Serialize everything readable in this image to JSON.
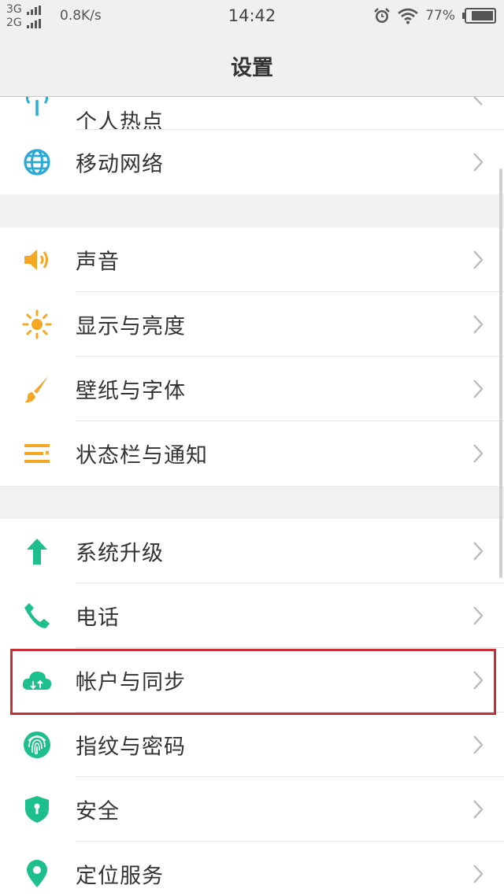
{
  "status": {
    "net1": "3G",
    "net2": "2G",
    "speed": "0.8K/s",
    "time": "14:42",
    "battery": "77%"
  },
  "header": {
    "title": "设置"
  },
  "groups": [
    {
      "items": [
        {
          "label": "个人热点",
          "icon": "hotspot-icon",
          "color": "#2ab0d6"
        },
        {
          "label": "移动网络",
          "icon": "globe-icon",
          "color": "#2aa8d6"
        }
      ]
    },
    {
      "items": [
        {
          "label": "声音",
          "icon": "speaker-icon",
          "color": "#f5a623"
        },
        {
          "label": "显示与亮度",
          "icon": "sun-icon",
          "color": "#f5a623"
        },
        {
          "label": "壁纸与字体",
          "icon": "brush-icon",
          "color": "#f5a623"
        },
        {
          "label": "状态栏与通知",
          "icon": "menu-list-icon",
          "color": "#f5a623"
        }
      ]
    },
    {
      "items": [
        {
          "label": "系统升级",
          "icon": "upgrade-arrow-icon",
          "color": "#1dbf8c"
        },
        {
          "label": "电话",
          "icon": "phone-icon",
          "color": "#1dbf8c"
        },
        {
          "label": "帐户与同步",
          "icon": "cloud-sync-icon",
          "color": "#1dbf8c"
        },
        {
          "label": "指纹与密码",
          "icon": "fingerprint-icon",
          "color": "#1dbf8c"
        },
        {
          "label": "安全",
          "icon": "shield-icon",
          "color": "#1dbf8c"
        },
        {
          "label": "定位服务",
          "icon": "location-pin-icon",
          "color": "#1dbf8c"
        }
      ]
    }
  ],
  "highlight_color": "#c62f35"
}
